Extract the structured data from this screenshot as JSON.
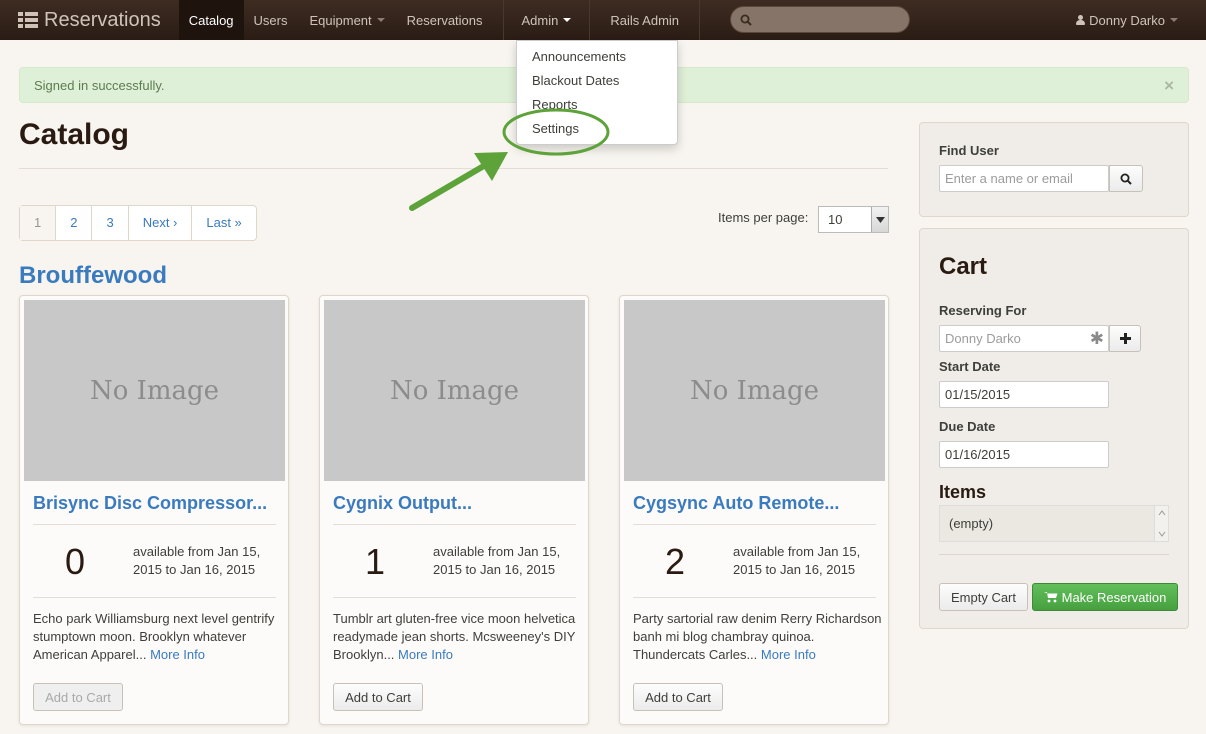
{
  "navbar": {
    "brand": "Reservations",
    "items": [
      {
        "label": "Catalog",
        "active": true
      },
      {
        "label": "Users",
        "active": false
      },
      {
        "label": "Equipment",
        "active": false
      },
      {
        "label": "Reservations",
        "active": false
      }
    ],
    "admin_label": "Admin",
    "rails_admin_label": "Rails Admin",
    "search_placeholder": "",
    "user_name": "Donny Darko"
  },
  "admin_dropdown": {
    "items": [
      "Announcements",
      "Blackout Dates",
      "Reports",
      "Settings"
    ]
  },
  "alert": {
    "message": "Signed in successfully.",
    "close": "×"
  },
  "page": {
    "title": "Catalog",
    "pagination": [
      "1",
      "2",
      "3",
      "Next ›",
      "Last »"
    ],
    "current_page": "1",
    "items_per_page_label": "Items per page:",
    "items_per_page_value": "10",
    "category": "Brouffewood"
  },
  "cards": [
    {
      "image_text": "No Image",
      "name": "Brisync Disc Compressor...",
      "count": "0",
      "availability": "available from Jan 15, 2015 to Jan 16, 2015",
      "description": "Echo park Williamsburg next level gentrify stumptown moon. Brooklyn whatever American Apparel...",
      "more_info": "More Info",
      "add_label": "Add to Cart",
      "add_disabled": true
    },
    {
      "image_text": "No Image",
      "name": "Cygnix Output...",
      "count": "1",
      "availability": "available from Jan 15, 2015 to Jan 16, 2015",
      "description": "Tumblr art gluten-free vice moon helvetica readymade jean shorts. Mcsweeney's DIY Brooklyn...",
      "more_info": "More Info",
      "add_label": "Add to Cart",
      "add_disabled": false
    },
    {
      "image_text": "No Image",
      "name": "Cygsync Auto Remote...",
      "count": "2",
      "availability": "available from Jan 15, 2015 to Jan 16, 2015",
      "description": "Party sartorial raw denim Rerry Richardson banh mi blog chambray quinoa. Thundercats Carles...",
      "more_info": "More Info",
      "add_label": "Add to Cart",
      "add_disabled": false
    }
  ],
  "find_user": {
    "label": "Find User",
    "placeholder": "Enter a name or email"
  },
  "cart": {
    "title": "Cart",
    "reserving_for_label": "Reserving For",
    "reserving_for_value": "Donny Darko",
    "start_date_label": "Start Date",
    "start_date_value": "01/15/2015",
    "due_date_label": "Due Date",
    "due_date_value": "01/16/2015",
    "items_label": "Items",
    "items_value": "(empty)",
    "empty_cart_label": "Empty Cart",
    "make_reservation_label": "Make Reservation"
  },
  "colors": {
    "navbar": "#2a1c14",
    "link": "#3a7bbf",
    "success_button": "#4cae4c",
    "annotation": "#5ea33a"
  }
}
